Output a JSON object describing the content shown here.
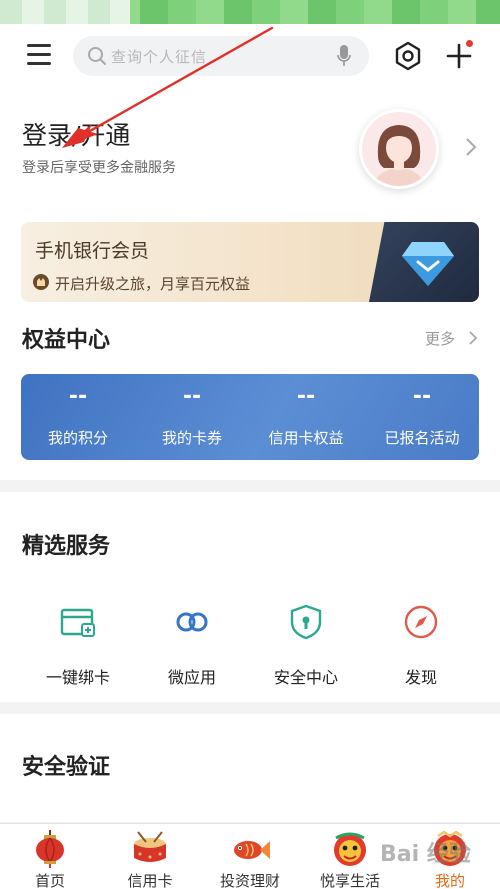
{
  "search": {
    "placeholder": "查询个人征信"
  },
  "login": {
    "title": "登录/开通",
    "subtitle": "登录后享受更多金融服务"
  },
  "member_banner": {
    "title": "手机银行会员",
    "subtitle": "开启升级之旅，月享百元权益"
  },
  "rights": {
    "title": "权益中心",
    "more": "更多",
    "items": [
      {
        "value": "--",
        "label": "我的积分"
      },
      {
        "value": "--",
        "label": "我的卡券"
      },
      {
        "value": "--",
        "label": "信用卡权益"
      },
      {
        "value": "--",
        "label": "已报名活动"
      }
    ]
  },
  "services": {
    "title": "精选服务",
    "items": [
      {
        "label": "一键绑卡",
        "icon": "bind-card-icon"
      },
      {
        "label": "微应用",
        "icon": "link-icon"
      },
      {
        "label": "安全中心",
        "icon": "shield-icon"
      },
      {
        "label": "发现",
        "icon": "compass-icon"
      }
    ]
  },
  "verify": {
    "title": "安全验证"
  },
  "tabs": [
    {
      "label": "首页",
      "icon": "lantern-icon"
    },
    {
      "label": "信用卡",
      "icon": "drum-icon"
    },
    {
      "label": "投资理财",
      "icon": "fish-icon"
    },
    {
      "label": "悦享生活",
      "icon": "lion-icon"
    },
    {
      "label": "我的",
      "icon": "lion-head-icon",
      "active": true
    }
  ],
  "watermark": "Bai 经验",
  "colors": {
    "accent_green": "#2ca88f",
    "active_tab": "#e26b16",
    "rights_blue": "#4a7cc7",
    "annotation_red": "#e0302a"
  }
}
